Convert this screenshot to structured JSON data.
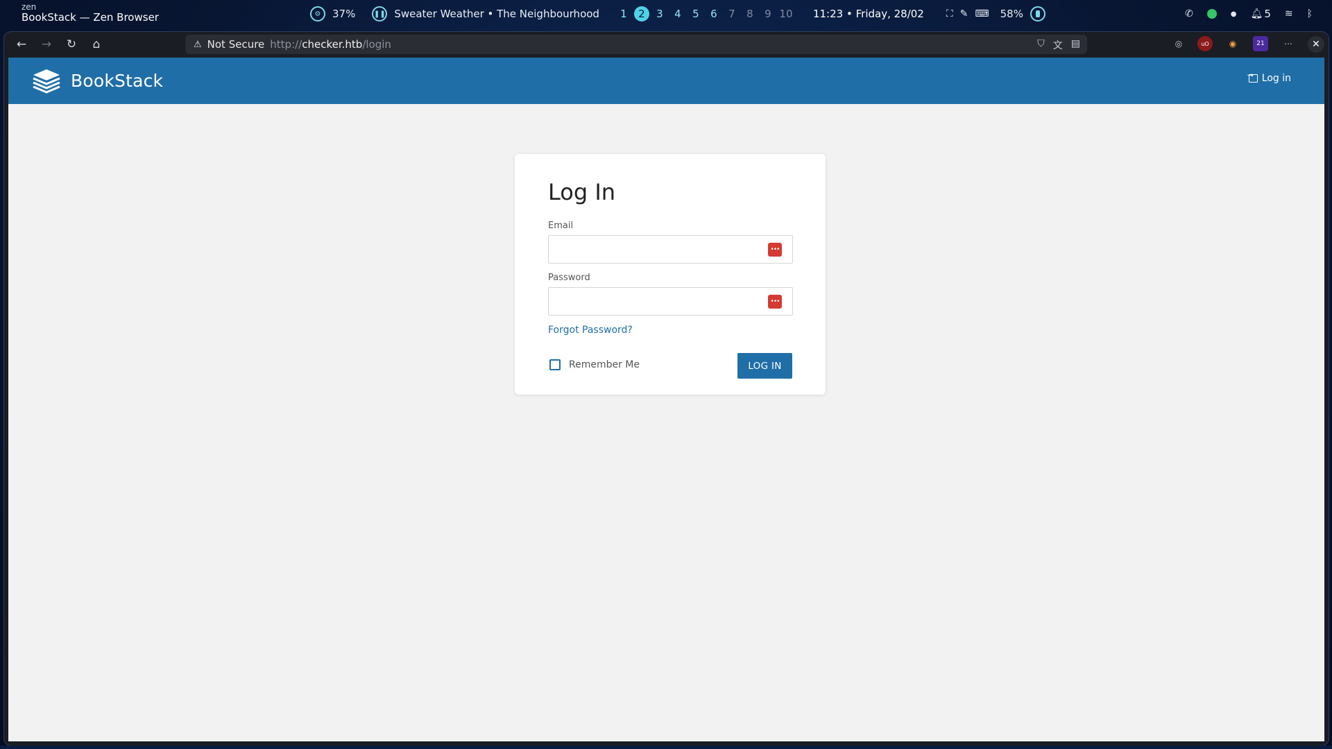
{
  "system_bar": {
    "app_name": "zen",
    "window_title": "BookStack — Zen Browser",
    "cpu_percent": "37%",
    "media_title": "Sweater Weather • The Neighbourhood",
    "workspaces": [
      "1",
      "2",
      "3",
      "4",
      "5",
      "6",
      "7",
      "8",
      "9",
      "10"
    ],
    "active_workspace": "2",
    "time": "11:23",
    "date_sep": "•",
    "date": "Friday, 28/02",
    "battery_percent": "58%",
    "notifications_count": "5"
  },
  "browser": {
    "security_label": "Not Secure",
    "url_prefix": "http://",
    "url_host": "checker.htb",
    "url_path": "/login",
    "ext_badge": "21"
  },
  "app": {
    "brand": "BookStack",
    "header_login": "Log in"
  },
  "login_form": {
    "heading": "Log In",
    "email_label": "Email",
    "email_value": "",
    "password_label": "Password",
    "password_value": "",
    "forgot_link": "Forgot Password?",
    "remember_label": "Remember Me",
    "remember_checked": false,
    "submit_label": "LOG IN"
  },
  "colors": {
    "brand_blue": "#206ea7",
    "page_background": "#f2f2f2",
    "password_manager_red": "#d53b30"
  }
}
